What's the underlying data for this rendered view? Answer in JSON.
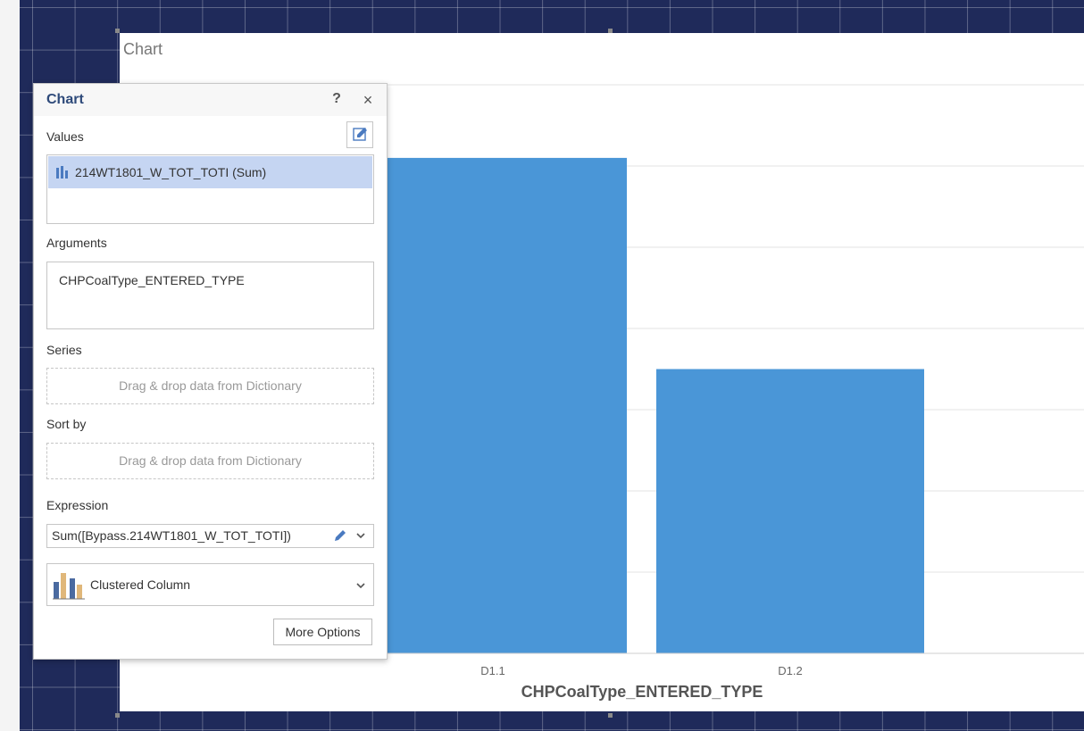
{
  "chart_component": {
    "title": "Chart"
  },
  "chart_data": {
    "type": "bar",
    "categories": [
      "D1.1",
      "D1.2"
    ],
    "values": [
      61,
      35
    ],
    "xlabel": "CHPCoalType_ENTERED_TYPE",
    "ylim": [
      0,
      70
    ],
    "grid": true,
    "bar_color": "#4a96d7"
  },
  "panel": {
    "title": "Chart",
    "help_label": "?",
    "close_label": "×",
    "values_label": "Values",
    "value_item": "214WT1801_W_TOT_TOTI (Sum)",
    "arguments_label": "Arguments",
    "argument_item": "CHPCoalType_ENTERED_TYPE",
    "series_label": "Series",
    "series_placeholder": "Drag & drop data from Dictionary",
    "sortby_label": "Sort by",
    "sortby_placeholder": "Drag & drop data from Dictionary",
    "expression_label": "Expression",
    "expression_value": "Sum([Bypass.214WT1801_W_TOT_TOTI])",
    "chart_type": "Clustered Column",
    "more_options_label": "More Options"
  },
  "colors": {
    "canvas_background": "#1f2a5a",
    "bar": "#4a96d7",
    "selected_item": "#c5d5f2",
    "panel_title": "#2e4a7a"
  }
}
